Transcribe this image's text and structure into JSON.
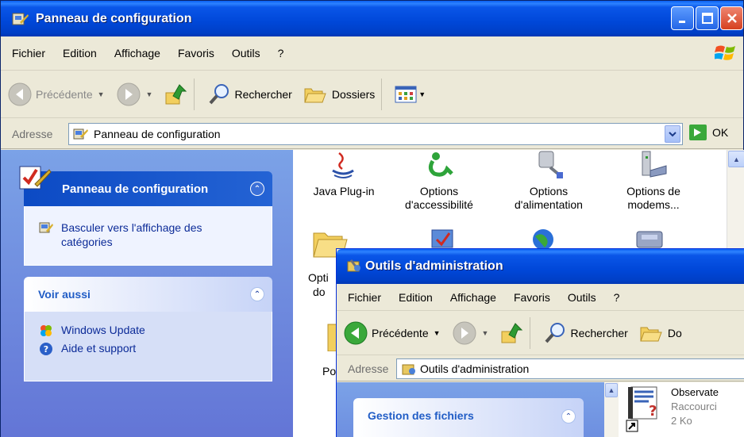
{
  "main": {
    "title": "Panneau de configuration",
    "menu": [
      "Fichier",
      "Edition",
      "Affichage",
      "Favoris",
      "Outils",
      "?"
    ],
    "toolbar": {
      "back": "Précédente",
      "search": "Rechercher",
      "folders": "Dossiers"
    },
    "address": {
      "label": "Adresse",
      "value": "Panneau de configuration",
      "go": "OK"
    },
    "sidepanel": {
      "cp_title": "Panneau de configuration",
      "switch_link": "Basculer vers l'affichage des catégories",
      "see_also_title": "Voir aussi",
      "see_also_links": [
        "Windows Update",
        "Aide et support"
      ]
    },
    "items": [
      {
        "label": "Java Plug-in",
        "icon": "java-icon"
      },
      {
        "label": "Options d'accessibilité",
        "icon": "accessibility-icon"
      },
      {
        "label": "Options d'alimentation",
        "icon": "power-icon"
      },
      {
        "label": "Options de modems...",
        "icon": "modem-icon"
      },
      {
        "label": "Opti",
        "icon": "folder-options-icon"
      },
      {
        "label": "do",
        "icon": "folder-options-icon-line2"
      },
      {
        "label": "Po",
        "icon": "partial-icon"
      }
    ]
  },
  "admin": {
    "title": "Outils d'administration",
    "menu": [
      "Fichier",
      "Edition",
      "Affichage",
      "Favoris",
      "Outils",
      "?"
    ],
    "toolbar": {
      "back": "Précédente",
      "search": "Rechercher",
      "folders": "Do"
    },
    "address": {
      "label": "Adresse",
      "value": "Outils d'administration"
    },
    "side_title": "Gestion des fichiers",
    "file": {
      "name": "Observate",
      "type": "Raccourci",
      "size": "2 Ko"
    }
  },
  "colors": {
    "titlebar": "#0047d8",
    "sidepane": "#7ba2e7",
    "link": "#0c2b98",
    "panelhead": "#215dc6"
  }
}
